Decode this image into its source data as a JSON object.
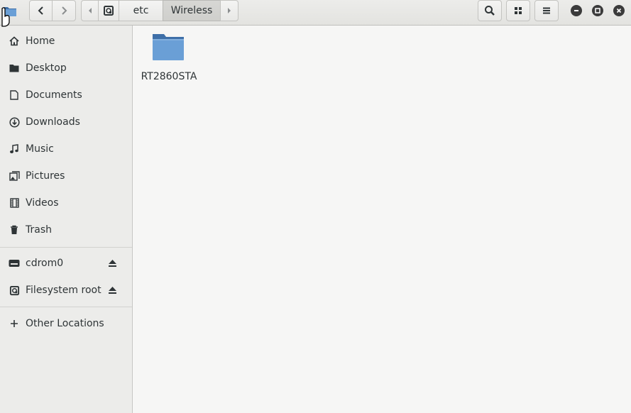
{
  "header": {
    "app_icon": "folder-icon",
    "nav": {
      "back_icon": "chevron-left-icon",
      "forward_icon": "chevron-right-icon"
    },
    "pathbar": {
      "scroll_left_icon": "triangle-left-icon",
      "root_icon": "disk-icon",
      "segments": [
        "etc",
        "Wireless"
      ],
      "active_segment": "Wireless",
      "scroll_right_icon": "triangle-right-icon"
    },
    "tools": {
      "search_icon": "search-icon",
      "view_icon": "grid-view-icon",
      "menu_icon": "hamburger-menu-icon"
    },
    "window_controls": [
      "minimize-icon",
      "maximize-icon",
      "close-icon"
    ]
  },
  "sidebar": {
    "places": [
      {
        "label": "Home",
        "icon": "home-icon"
      },
      {
        "label": "Desktop",
        "icon": "folder-icon"
      },
      {
        "label": "Documents",
        "icon": "document-icon"
      },
      {
        "label": "Downloads",
        "icon": "download-icon"
      },
      {
        "label": "Music",
        "icon": "music-icon"
      },
      {
        "label": "Pictures",
        "icon": "picture-icon"
      },
      {
        "label": "Videos",
        "icon": "film-icon"
      },
      {
        "label": "Trash",
        "icon": "trash-icon"
      }
    ],
    "devices": [
      {
        "label": "cdrom0",
        "icon": "drive-icon",
        "eject": "eject-icon"
      },
      {
        "label": "Filesystem root",
        "icon": "disk-icon",
        "eject": "eject-icon"
      }
    ],
    "other": {
      "label": "Other Locations",
      "icon": "plus-icon"
    }
  },
  "main": {
    "items": [
      {
        "name": "RT2860STA",
        "type": "folder"
      }
    ]
  },
  "colors": {
    "folder_body": "#6a9fd6",
    "folder_tab": "#3e6fa8",
    "sidebar_bg": "#ececea",
    "view_bg": "#f6f6f5",
    "text": "#2e3436"
  }
}
